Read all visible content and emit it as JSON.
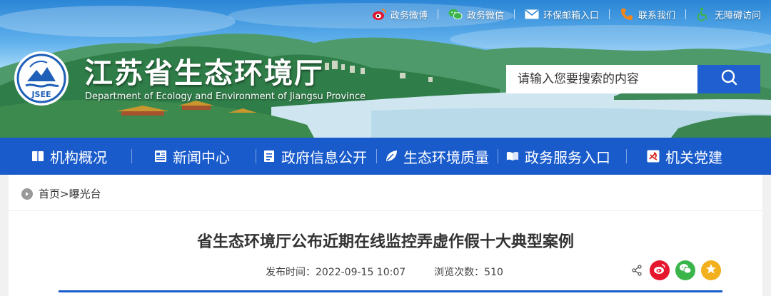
{
  "header": {
    "title": "江苏省生态环境厅",
    "subtitle": "Department of Ecology and Environment of Jiangsu Province",
    "logo_text": "JSEE",
    "top_links": [
      {
        "label": "政务微博",
        "icon": "weibo-icon"
      },
      {
        "label": "政务微信",
        "icon": "wechat-icon"
      },
      {
        "label": "环保邮箱入口",
        "icon": "mail-icon"
      },
      {
        "label": "联系我们",
        "icon": "phone-icon"
      },
      {
        "label": "无障碍访问",
        "icon": "accessibility-icon"
      }
    ],
    "search": {
      "placeholder": "请输入您要搜索的内容"
    }
  },
  "nav": {
    "items": [
      {
        "label": "机构概况",
        "icon": "book-icon"
      },
      {
        "label": "新闻中心",
        "icon": "newspaper-icon"
      },
      {
        "label": "政府信息公开",
        "icon": "document-icon"
      },
      {
        "label": "生态环境质量",
        "icon": "leaf-icon"
      },
      {
        "label": "政务服务入口",
        "icon": "open-book-icon"
      },
      {
        "label": "机关党建",
        "icon": "party-emblem-icon"
      }
    ]
  },
  "breadcrumb": {
    "home": "首页",
    "separator": ">",
    "current": "曝光台"
  },
  "article": {
    "title": "省生态环境厅公布近期在线监控弄虚作假十大典型案例",
    "publish_label": "发布时间：",
    "publish_time": "2022-09-15 10:07",
    "views_label": "浏览次数：",
    "views": "510"
  },
  "share": [
    "share-icon",
    "weibo-icon",
    "wechat-icon",
    "qzone-icon"
  ],
  "colors": {
    "nav_blue": "#1a5bcc",
    "search_button": "#1f5fd0",
    "weibo_red": "#e6162d",
    "wechat_green": "#39b54a",
    "qzone_yellow": "#f2b01e"
  }
}
